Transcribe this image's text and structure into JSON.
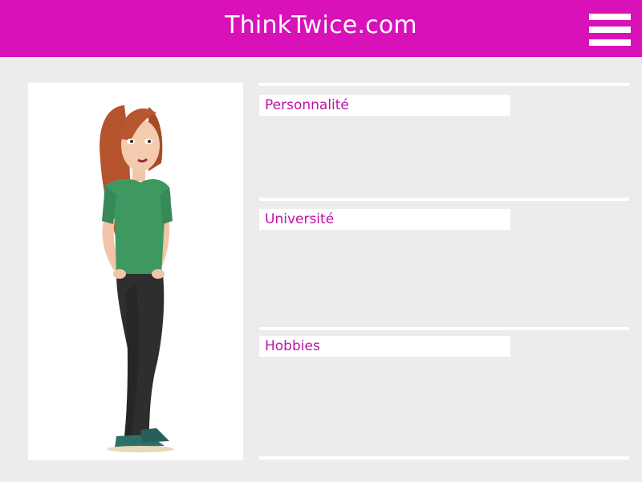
{
  "header": {
    "title": "ThinkTwice.com",
    "background": "#d811b8",
    "menu_icon": "hamburger-menu-icon"
  },
  "profile": {
    "illustration": "woman-character-illustration"
  },
  "sections": [
    {
      "label": "Personnalité"
    },
    {
      "label": "Université"
    },
    {
      "label": "Hobbies"
    }
  ],
  "colors": {
    "accent": "#d811b8",
    "label_text": "#c010a8",
    "page_background": "#ececec"
  }
}
